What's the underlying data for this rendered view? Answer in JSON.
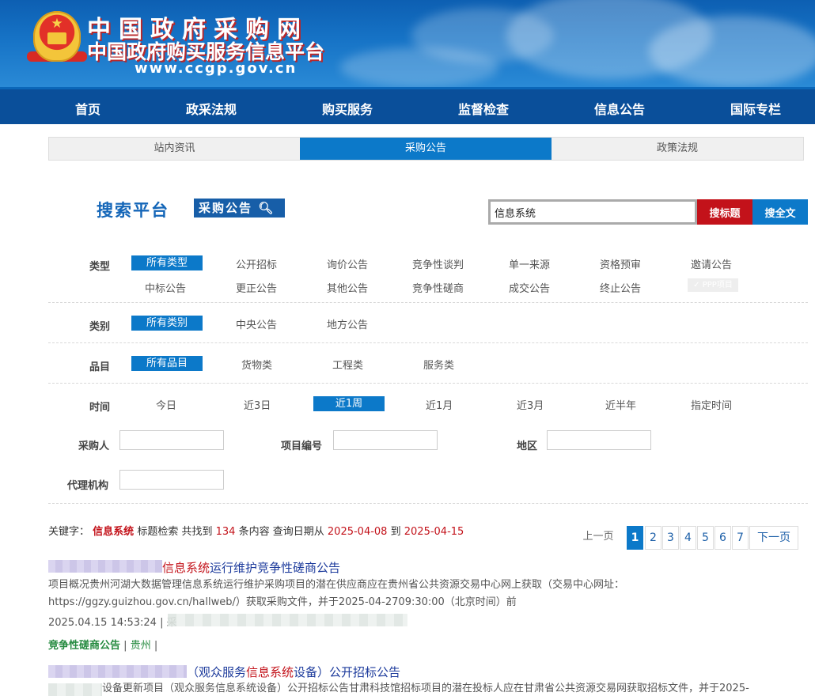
{
  "header": {
    "title_line1": "中国政府采购网",
    "title_line2": "中国政府购买服务信息平台",
    "url": "www.ccgp.gov.cn"
  },
  "nav": {
    "items": [
      "首页",
      "政采法规",
      "购买服务",
      "监督检查",
      "信息公告",
      "国际专栏"
    ]
  },
  "subtabs": {
    "items": [
      "站内资讯",
      "采购公告",
      "政策法规"
    ],
    "active": "采购公告"
  },
  "search": {
    "platform_label": "搜索平台",
    "badge_label": "采购公告",
    "value": "信息系统",
    "btn_title": "搜标题",
    "btn_full": "搜全文"
  },
  "filters": {
    "type_label": "类型",
    "type_row1": [
      "所有类型",
      "公开招标",
      "询价公告",
      "竞争性谈判",
      "单一来源",
      "资格预审",
      "邀请公告"
    ],
    "type_row2": [
      "中标公告",
      "更正公告",
      "其他公告",
      "竞争性磋商",
      "成交公告",
      "终止公告"
    ],
    "ppp_label": "✓ PPP项目",
    "category_label": "类别",
    "category_opts": [
      "所有类别",
      "中央公告",
      "地方公告"
    ],
    "item_label": "品目",
    "item_opts": [
      "所有品目",
      "货物类",
      "工程类",
      "服务类"
    ],
    "time_label": "时间",
    "time_opts": [
      "今日",
      "近3日",
      "近1周",
      "近1月",
      "近3月",
      "近半年",
      "指定时间"
    ],
    "purchaser_label": "采购人",
    "project_no_label": "项目编号",
    "region_label": "地区",
    "agency_label": "代理机构"
  },
  "summary": {
    "prefix": "关键字：",
    "keyword": "信息系统",
    "mode": "标题检索",
    "found_text": "共找到",
    "count": "134",
    "unit": "条内容",
    "date_text": "查询日期从",
    "date_from": "2025-04-08",
    "to_text": "到",
    "date_to": "2025-04-15"
  },
  "pager": {
    "prev": "上一页",
    "pages": [
      "1",
      "2",
      "3",
      "4",
      "5",
      "6",
      "7"
    ],
    "current": "1",
    "next": "下一页"
  },
  "results": [
    {
      "title_hl": "信息系统",
      "title_after": "运行维护竞争性磋商公告",
      "desc_line1": "项目概况贵州河湖大数据管理信息系统运行维护采购项目的潜在供应商应在贵州省公共资源交易中心网上获取（交易中心网址：",
      "desc_line2": "https://ggzy.guizhou.gov.cn/hallweb/）获取采购文件，并于2025-04-2709:30:00（北京时间）前",
      "time": "2025.04.15 14:53:24 | 采",
      "category": "竞争性磋商公告",
      "sep": "|",
      "region": "贵州",
      "sep2": "|"
    },
    {
      "title_pre": "（观众服务",
      "title_hl": "信息系统",
      "title_after": "设备）公开招标公告",
      "desc_line1": "设备更新项目（观众服务信息系统设备）公开招标公告甘肃科技馆招标项目的潜在投标人应在甘肃省公共资源交易网获取招标文件，并于2025-"
    }
  ]
}
